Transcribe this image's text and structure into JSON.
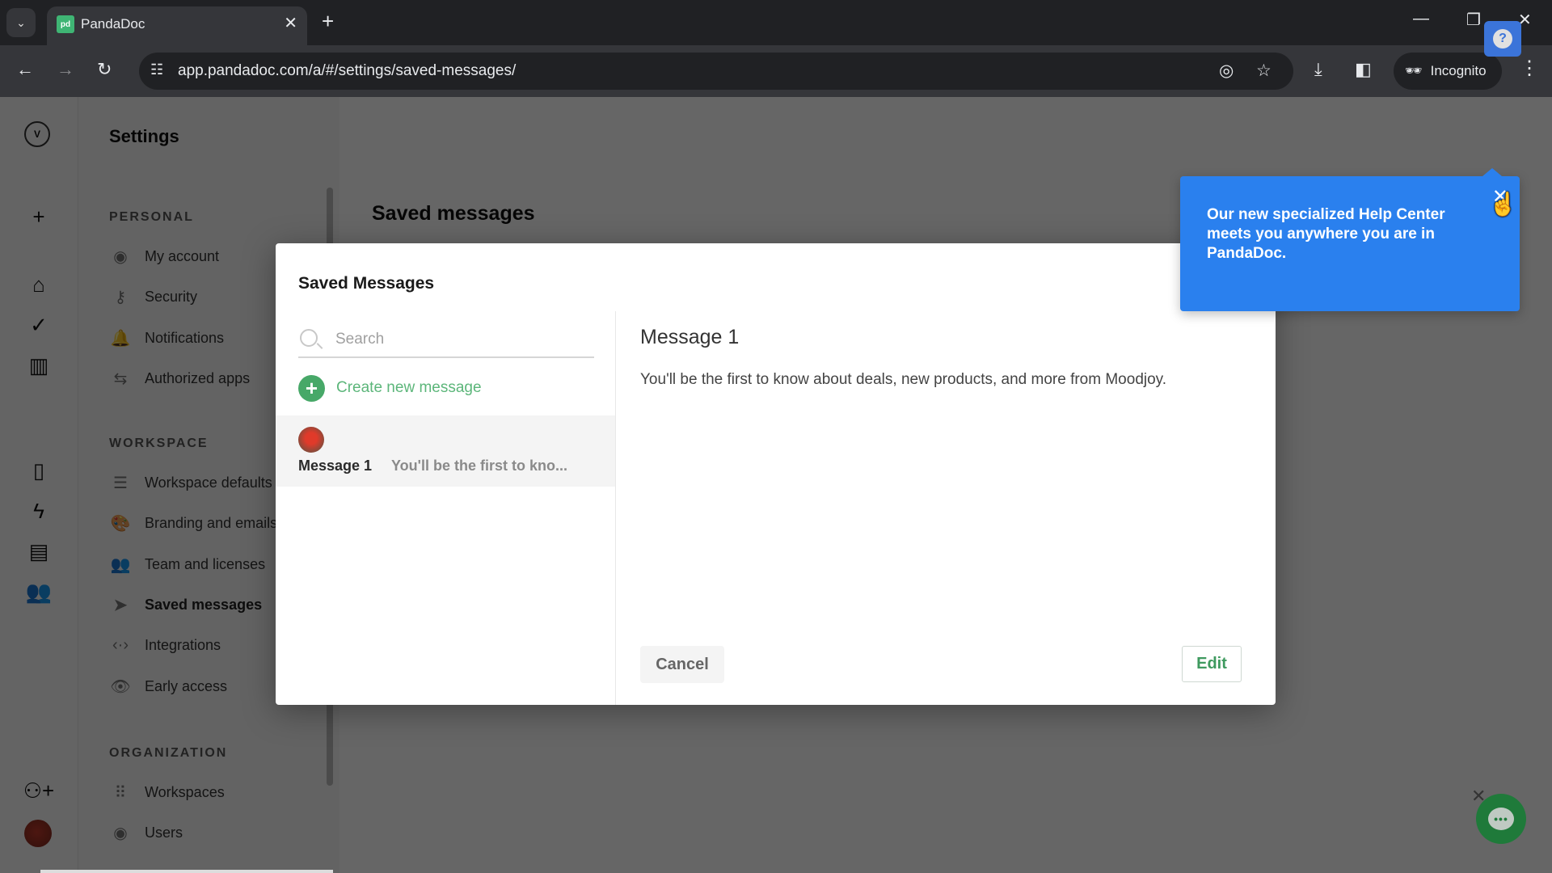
{
  "browser": {
    "tab_title": "PandaDoc",
    "tab_favicon": "pd",
    "url": "app.pandadoc.com/a/#/settings/saved-messages/",
    "incognito_label": "Incognito",
    "icons": {
      "tab_list": "chevron-down-icon",
      "new_tab": "plus-icon",
      "back": "back-arrow-icon",
      "forward": "forward-arrow-icon",
      "reload": "reload-icon",
      "site_info": "tune-icon",
      "eye_off": "eye-off-icon",
      "star": "star-icon",
      "download": "download-icon",
      "side_panel": "side-panel-icon",
      "menu": "kebab-menu-icon"
    }
  },
  "rail": {
    "items": [
      {
        "name": "logo"
      },
      {
        "name": "create-new",
        "glyph": "+"
      },
      {
        "name": "home"
      },
      {
        "name": "tasks"
      },
      {
        "name": "reports"
      },
      {
        "name": "documents"
      },
      {
        "name": "automations"
      },
      {
        "name": "templates"
      },
      {
        "name": "contacts"
      },
      {
        "name": "invite-user"
      },
      {
        "name": "user-avatar"
      }
    ]
  },
  "settings": {
    "title": "Settings",
    "sections": [
      {
        "label": "PERSONAL",
        "items": [
          {
            "label": "My account",
            "icon": "user-circle-icon"
          },
          {
            "label": "Security",
            "icon": "key-icon"
          },
          {
            "label": "Notifications",
            "icon": "bell-icon"
          },
          {
            "label": "Authorized apps",
            "icon": "swap-arrows-icon"
          }
        ]
      },
      {
        "label": "WORKSPACE",
        "items": [
          {
            "label": "Workspace defaults",
            "icon": "sliders-icon"
          },
          {
            "label": "Branding and emails",
            "icon": "palette-icon"
          },
          {
            "label": "Team and licenses",
            "icon": "team-icon"
          },
          {
            "label": "Saved messages",
            "icon": "send-icon",
            "active": true
          },
          {
            "label": "Integrations",
            "icon": "code-icon"
          },
          {
            "label": "Early access",
            "icon": "eye-icon"
          }
        ]
      },
      {
        "label": "ORGANIZATION",
        "items": [
          {
            "label": "Workspaces",
            "icon": "grid-icon"
          },
          {
            "label": "Users",
            "icon": "user-circle-icon"
          }
        ]
      }
    ]
  },
  "main": {
    "page_title": "Saved messages",
    "help_label": "?"
  },
  "modal": {
    "title": "Saved Messages",
    "search_placeholder": "Search",
    "search_value": "",
    "create_label": "Create new message",
    "messages": [
      {
        "name": "Message 1",
        "preview": "You'll be the first to kno...",
        "selected": true
      }
    ],
    "detail": {
      "title": "Message 1",
      "body": "You'll be the first to know about deals, new products, and more from Moodjoy."
    },
    "cancel_label": "Cancel",
    "edit_label": "Edit"
  },
  "popover": {
    "text": "Our new specialized Help Center meets you anywhere you are in PandaDoc.",
    "close_glyph": "✕"
  },
  "chat": {
    "dots": "•••",
    "close_glyph": "✕"
  },
  "colors": {
    "brand_green": "#47a868",
    "help_blue": "#2a80ee",
    "chat_green": "#1f7a3a"
  }
}
